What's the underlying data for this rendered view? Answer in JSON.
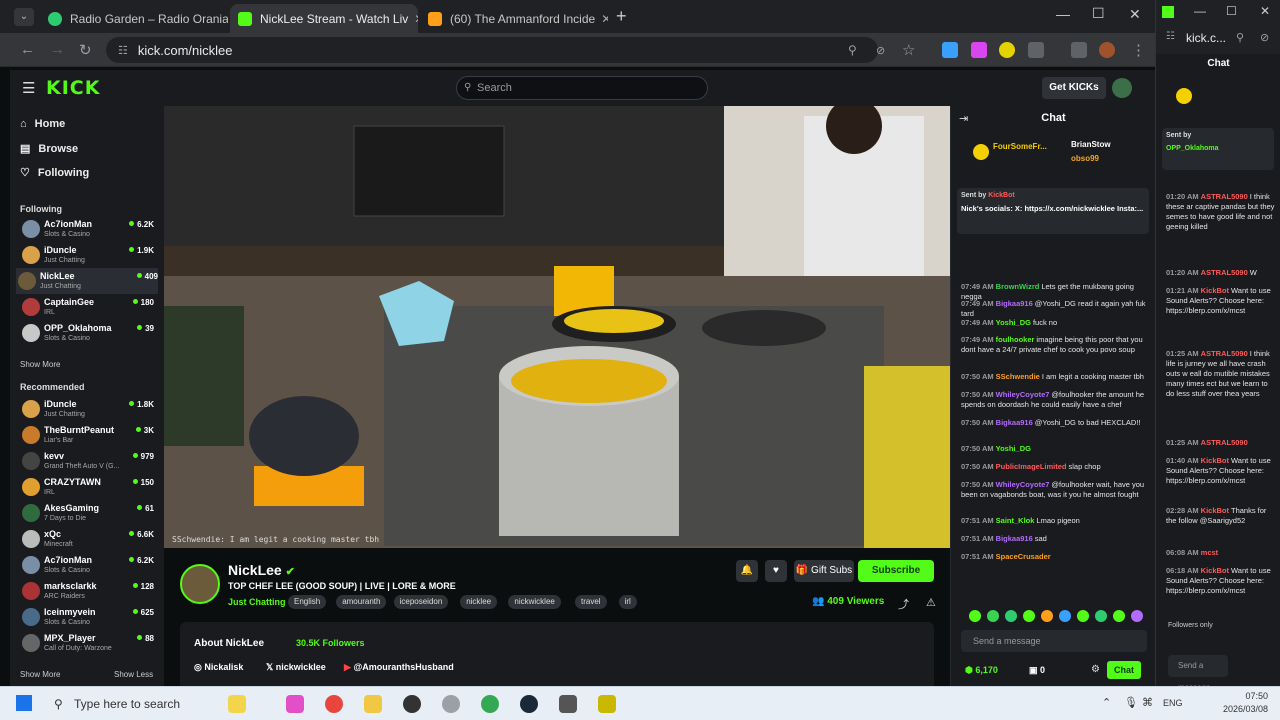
{
  "browser": {
    "tabs": [
      {
        "label": "Radio Garden – Radio Orania 9",
        "color": "#2ecc71"
      },
      {
        "label": "NickLee Stream - Watch Liv",
        "color": "#53fc18"
      },
      {
        "label": "(60) The Ammanford Incide",
        "color": "#ff9f1a"
      }
    ],
    "url": "kick.com/nicklee"
  },
  "kick": {
    "logo": "KICK",
    "search_placeholder": "Search",
    "get_kicks": "Get KICKs",
    "nav": [
      "Home",
      "Browse",
      "Following"
    ],
    "following_title": "Following",
    "following": [
      {
        "name": "Ac7ionMan",
        "category": "Slots & Casino",
        "viewers": "6.2K"
      },
      {
        "name": "iDuncle",
        "category": "Just Chatting",
        "viewers": "1.9K"
      },
      {
        "name": "NickLee",
        "category": "Just Chatting",
        "viewers": "409"
      },
      {
        "name": "CaptainGee",
        "category": "IRL",
        "viewers": "180"
      },
      {
        "name": "OPP_Oklahoma",
        "category": "Slots & Casino",
        "viewers": "39"
      }
    ],
    "show_more": "Show More",
    "recommended_title": "Recommended",
    "recommended": [
      {
        "name": "iDuncle",
        "category": "Just Chatting",
        "viewers": "1.8K"
      },
      {
        "name": "TheBurntPeanut",
        "category": "Liar's Bar",
        "viewers": "3K"
      },
      {
        "name": "kevv",
        "category": "Grand Theft Auto V (G...",
        "viewers": "979"
      },
      {
        "name": "CRAZYTAWN",
        "category": "IRL",
        "viewers": "150"
      },
      {
        "name": "AkesGaming",
        "category": "7 Days to Die",
        "viewers": "61"
      },
      {
        "name": "xQc",
        "category": "Minecraft",
        "viewers": "6.6K"
      },
      {
        "name": "Ac7ionMan",
        "category": "Slots & Casino",
        "viewers": "6.2K"
      },
      {
        "name": "marksclarkk",
        "category": "ARC Raiders",
        "viewers": "128"
      },
      {
        "name": "Iceinmyvein",
        "category": "Slots & Casino",
        "viewers": "625"
      },
      {
        "name": "MPX_Player",
        "category": "Call of Duty: Warzone",
        "viewers": "88"
      }
    ],
    "show_more_2": "Show More",
    "show_less": "Show Less",
    "video_caption": "SSchwendie: I am legit a cooking master tbh",
    "stream": {
      "name": "NickLee",
      "title": "TOP CHEF LEE (GOOD SOUP) | LIVE | LORE & MORE",
      "category": "Just Chatting",
      "tags": [
        "English",
        "amouranth",
        "iceposeidon",
        "nicklee",
        "nickwicklee",
        "travel",
        "irl"
      ],
      "viewers": "409 Viewers",
      "gift_subs": "Gift Subs",
      "subscribe": "Subscribe",
      "about": "About NickLee",
      "followers": "30.5K Followers",
      "socials": [
        "Nickalisk",
        "nickwicklee",
        "@AmouranthsHusband"
      ]
    }
  },
  "chat": {
    "title": "Chat",
    "gifters": [
      "FourSomeFr...",
      "BrianStow",
      "obso99"
    ],
    "pinned_label": "Sent by",
    "pinned_user": "KickBot",
    "pinned_text": "Nick's socials: X: https://x.com/nickwicklee Insta:...",
    "messages": [
      {
        "time": "07:49 AM",
        "user": "BrownWizrd",
        "color": "#39d353",
        "text": "Lets get the mukbang going negga"
      },
      {
        "time": "07:49 AM",
        "user": "Bigkaa916",
        "color": "#b36bff",
        "text": "@Yoshi_DG read it again yah fuk tard"
      },
      {
        "time": "07:49 AM",
        "user": "Yoshi_DG",
        "color": "#53fc18",
        "text": "fuck no"
      },
      {
        "time": "07:49 AM",
        "user": "foulhooker",
        "color": "#53fc18",
        "text": "imagine being this poor that you dont have a 24/7 private chef to cook you povo soup"
      },
      {
        "time": "07:50 AM",
        "user": "SSchwendie",
        "color": "#ff9f1a",
        "text": "I am legit a cooking master tbh"
      },
      {
        "time": "07:50 AM",
        "user": "WhileyCoyote7",
        "color": "#b36bff",
        "text": "@foulhooker the amount he spends on doordash he could easily have a chef"
      },
      {
        "time": "07:50 AM",
        "user": "Bigkaa916",
        "color": "#b36bff",
        "text": "@Yoshi_DG to bad HEXCLAD!!"
      },
      {
        "time": "07:50 AM",
        "user": "Yoshi_DG",
        "color": "#53fc18",
        "text": ""
      },
      {
        "time": "07:50 AM",
        "user": "PublicImageLimited",
        "color": "#ff5a5a",
        "text": "slap chop"
      },
      {
        "time": "07:50 AM",
        "user": "WhileyCoyote7",
        "color": "#b36bff",
        "text": "@foulhooker wait, have you been on vagabonds boat, was it you he almost fought"
      },
      {
        "time": "07:51 AM",
        "user": "Saint_Klok",
        "color": "#53fc18",
        "text": "Lmao pigeon"
      },
      {
        "time": "07:51 AM",
        "user": "Bigkaa916",
        "color": "#b36bff",
        "text": "sad"
      },
      {
        "time": "07:51 AM",
        "user": "SpaceCrusader",
        "color": "#ff9f1a",
        "text": ""
      }
    ],
    "input_placeholder": "Send a message",
    "kicks_balance": "6,170",
    "count": "0",
    "send": "Chat"
  },
  "popout": {
    "url": "kick.c...",
    "title": "Chat",
    "sent_by": "Sent by",
    "sent_user": "OPP_Oklahoma",
    "messages": [
      {
        "time": "01:20 AM",
        "user": "ASTRAL5090",
        "color": "#ff5a5a",
        "text": "I think these ar captive pandas but they semes to have good life and not geeing killed"
      },
      {
        "time": "01:20 AM",
        "user": "ASTRAL5090",
        "color": "#ff5a5a",
        "text": "W"
      },
      {
        "time": "01:21 AM",
        "user": "KickBot",
        "color": "#ff5a5a",
        "text": "Want to use Sound Alerts?? Choose here: https://blerp.com/x/mcst"
      },
      {
        "time": "01:25 AM",
        "user": "ASTRAL5090",
        "color": "#ff5a5a",
        "text": "I think life is jurney we all have crash outs w eall do mutible mistakes many times ect but we learn to do less stuff over thea years"
      },
      {
        "time": "01:25 AM",
        "user": "ASTRAL5090",
        "color": "#ff5a5a",
        "text": ""
      },
      {
        "time": "01:40 AM",
        "user": "KickBot",
        "color": "#ff5a5a",
        "text": "Want to use Sound Alerts?? Choose here: https://blerp.com/x/mcst"
      },
      {
        "time": "02:28 AM",
        "user": "KickBot",
        "color": "#ff5a5a",
        "text": "Thanks for the follow @Saarigyd52"
      },
      {
        "time": "06:08 AM",
        "user": "mcst",
        "color": "#ff5a5a",
        "text": ""
      },
      {
        "time": "06:18 AM",
        "user": "KickBot",
        "color": "#ff5a5a",
        "text": "Want to use Sound Alerts?? Choose here: https://blerp.com/x/mcst"
      }
    ],
    "followers_only": "Followers only",
    "input_placeholder": "Send a message"
  },
  "taskbar": {
    "search_placeholder": "Type here to search",
    "lang": "ENG",
    "time": "07:50",
    "date": "2026/03/08"
  }
}
